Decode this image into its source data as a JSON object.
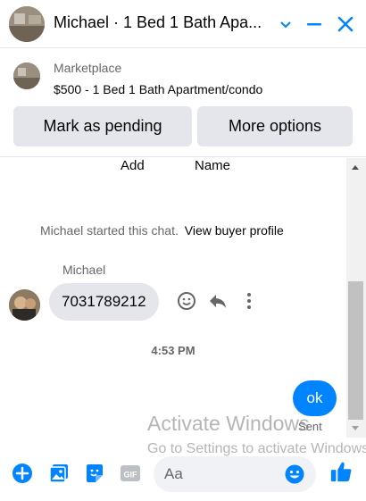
{
  "header": {
    "title": "Michael · 1 Bed 1 Bath Apa...",
    "icons": [
      "chevron-down-icon",
      "minimize-icon",
      "close-icon"
    ],
    "accent_color": "#0084ff"
  },
  "marketplace": {
    "label": "Marketplace",
    "listing": "$500 - 1 Bed 1 Bath Apartment/condo",
    "buttons": {
      "pending": "Mark as pending",
      "more": "More options"
    }
  },
  "chat": {
    "truncated_add": "Add",
    "truncated_name": "Name",
    "started_text": "Michael started this chat.",
    "view_profile": "View buyer profile",
    "sender_name": "Michael",
    "incoming_message": "7031789212",
    "timestamp": "4:53 PM",
    "outgoing_message": "ok",
    "status": "Sent"
  },
  "watermark": {
    "line1": "Activate Windows",
    "line2": "Go to Settings to activate Windows."
  },
  "composer": {
    "placeholder": "Aa",
    "icons": [
      "plus-icon",
      "photo-icon",
      "sticker-icon",
      "gif-icon",
      "emoji-icon",
      "like-icon"
    ],
    "gif_label": "GIF"
  }
}
